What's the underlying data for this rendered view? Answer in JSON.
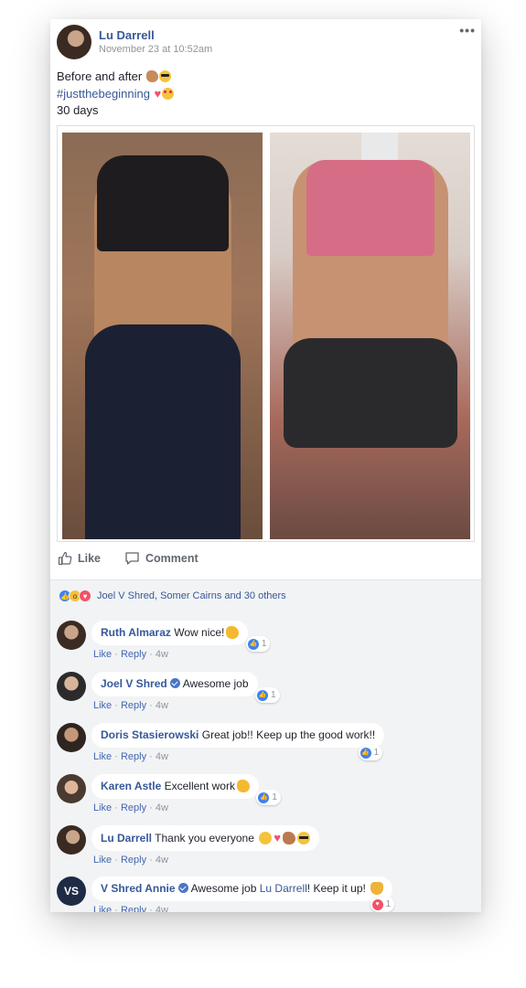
{
  "post": {
    "author": "Lu Darrell",
    "timestamp": "November 23 at 10:52am",
    "more_label": "•••",
    "line1": "Before and after",
    "hashtag": "#justthebeginning",
    "line3": "30 days",
    "photo_before_alt": "",
    "photo_after_alt": "",
    "like_label": "Like",
    "comment_label": "Comment"
  },
  "reactions": {
    "icons": [
      "like-icon",
      "wow-icon",
      "love-icon"
    ],
    "summary": "Joel V Shred, Somer Cairns and 30 others"
  },
  "comments": [
    {
      "name": "Ruth Almaraz",
      "text": "Wow nice!",
      "verified": false,
      "reaction_count": "1",
      "like": "Like",
      "reply": "Reply",
      "age": "4w"
    },
    {
      "name": "Joel V Shred",
      "text": "Awesome job",
      "verified": true,
      "reaction_count": "1",
      "like": "Like",
      "reply": "Reply",
      "age": "4w"
    },
    {
      "name": "Doris Stasierowski",
      "text": "Great job!! Keep up the good work!!",
      "verified": false,
      "reaction_count": "1",
      "like": "Like",
      "reply": "Reply",
      "age": "4w"
    },
    {
      "name": "Karen Astle",
      "text": "Excellent work",
      "verified": false,
      "reaction_count": "1",
      "like": "Like",
      "reply": "Reply",
      "age": "4w"
    },
    {
      "name": "Lu Darrell",
      "text": "Thank you everyone",
      "verified": false,
      "reaction_count": "",
      "like": "Like",
      "reply": "Reply",
      "age": "4w"
    },
    {
      "name": "V Shred Annie",
      "text": "Awesome job",
      "mention": "Lu Darrell",
      "text_after": "! Keep it up!",
      "verified": true,
      "reaction_count": "1",
      "like": "Like",
      "reply": "Reply",
      "age": "4w"
    }
  ],
  "separator": " · ",
  "colors": {
    "link": "#365899",
    "meta": "#90949c",
    "comments_bg": "#f2f3f5",
    "like_blue": "#3b82f6",
    "love_red": "#f25268"
  }
}
